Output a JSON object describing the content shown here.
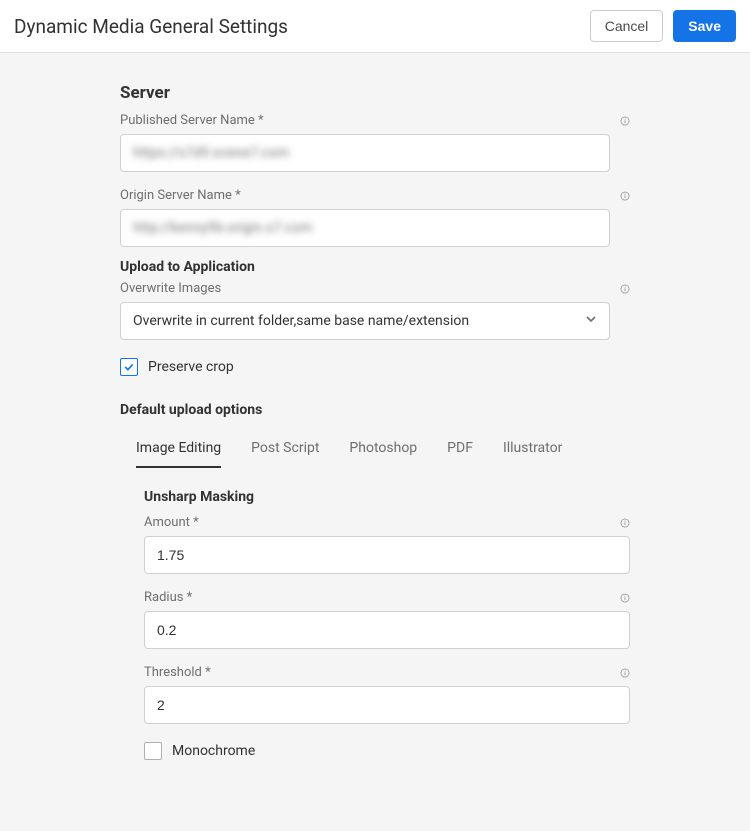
{
  "topbar": {
    "title": "Dynamic Media General Settings",
    "cancel": "Cancel",
    "save": "Save"
  },
  "server": {
    "heading": "Server",
    "published_label": "Published Server Name *",
    "published_value": "https://s7d9.scene7.com",
    "origin_label": "Origin Server Name *",
    "origin_value": "http://kenny9b.origin.s7.com"
  },
  "upload": {
    "heading": "Upload to Application",
    "overwrite_label": "Overwrite Images",
    "overwrite_selected": "Overwrite in current folder,same base name/extension",
    "preserve_crop_label": "Preserve crop",
    "preserve_crop_checked": true
  },
  "defaults": {
    "heading": "Default upload options",
    "tabs": [
      "Image Editing",
      "Post Script",
      "Photoshop",
      "PDF",
      "Illustrator"
    ],
    "active_tab": 0,
    "image_editing": {
      "section": "Unsharp Masking",
      "amount_label": "Amount *",
      "amount_value": "1.75",
      "radius_label": "Radius *",
      "radius_value": "0.2",
      "threshold_label": "Threshold *",
      "threshold_value": "2",
      "monochrome_label": "Monochrome",
      "monochrome_checked": false
    }
  }
}
